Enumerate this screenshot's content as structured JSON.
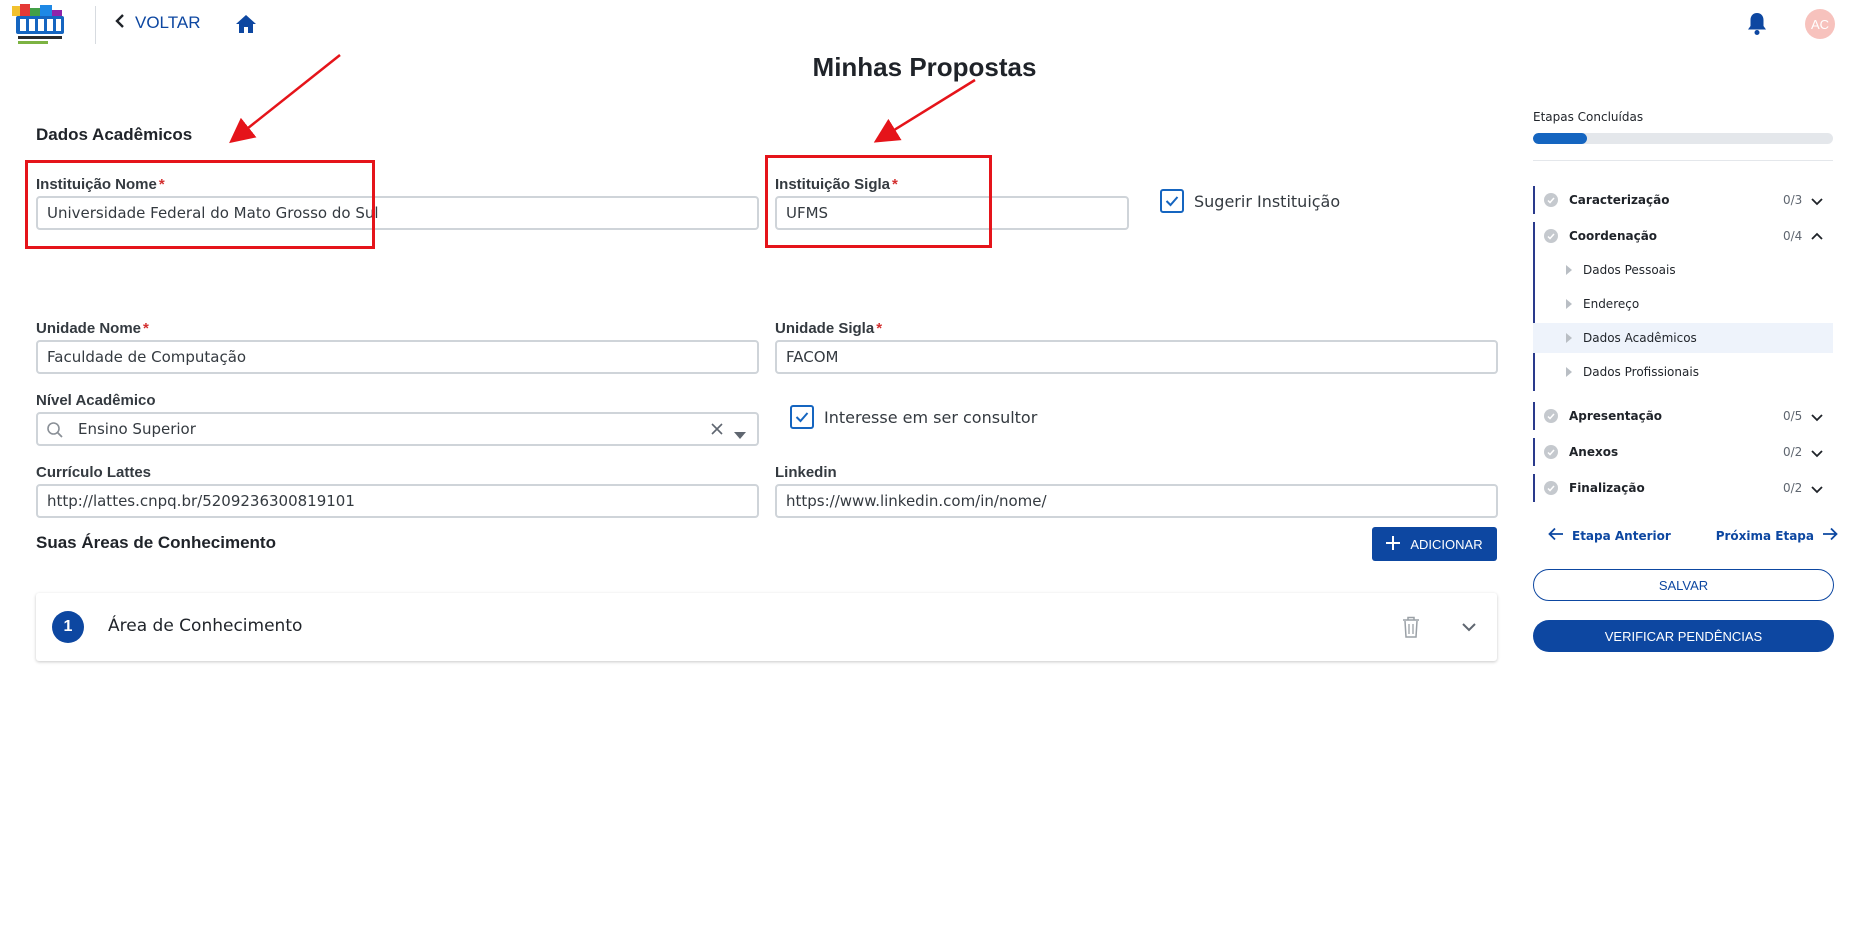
{
  "header": {
    "back_label": "VOLTAR",
    "avatar_initials": "AC"
  },
  "page_title": "Minhas Propostas",
  "section_title": "Dados Acadêmicos",
  "fields": {
    "instituicao_nome": {
      "label": "Instituição Nome",
      "required": "*",
      "value": "Universidade Federal do Mato Grosso do Sul"
    },
    "instituicao_sigla": {
      "label": "Instituição Sigla",
      "required": "*",
      "value": "UFMS"
    },
    "sugerir_instituicao": {
      "label": "Sugerir Instituição",
      "checked": true
    },
    "unidade_nome": {
      "label": "Unidade Nome",
      "required": "*",
      "value": "Faculdade de Computação"
    },
    "unidade_sigla": {
      "label": "Unidade Sigla",
      "required": "*",
      "value": "FACOM"
    },
    "nivel_academico": {
      "label": "Nível Acadêmico",
      "value": "Ensino Superior"
    },
    "interesse_consultor": {
      "label": "Interesse em ser consultor",
      "checked": true
    },
    "curriculo_lattes": {
      "label": "Currículo Lattes",
      "value": "http://lattes.cnpq.br/5209236300819101"
    },
    "linkedin": {
      "label": "Linkedin",
      "value": "https://www.linkedin.com/in/nome/"
    }
  },
  "areas": {
    "title": "Suas Áreas de Conhecimento",
    "add_label": "ADICIONAR",
    "items": [
      {
        "number": "1",
        "title": "Área de Conhecimento"
      }
    ]
  },
  "sidebar": {
    "progress_label": "Etapas Concluídas",
    "progress_fraction": 0.18,
    "steps": [
      {
        "name": "Caracterização",
        "count": "0/3",
        "expanded": false
      },
      {
        "name": "Coordenação",
        "count": "0/4",
        "expanded": true
      },
      {
        "name": "Apresentação",
        "count": "0/5",
        "expanded": false
      },
      {
        "name": "Anexos",
        "count": "0/2",
        "expanded": false
      },
      {
        "name": "Finalização",
        "count": "0/2",
        "expanded": false
      }
    ],
    "substeps": [
      {
        "name": "Dados Pessoais"
      },
      {
        "name": "Endereço"
      },
      {
        "name": "Dados Acadêmicos",
        "active": true
      },
      {
        "name": "Dados Profissionais"
      }
    ],
    "prev_label": "Etapa Anterior",
    "next_label": "Próxima Etapa",
    "save_label": "SALVAR",
    "verify_label": "VERIFICAR PENDÊNCIAS"
  },
  "colors": {
    "primary": "#0d47a1",
    "annotation_red": "#e5141a",
    "required": "#d32f2f"
  }
}
